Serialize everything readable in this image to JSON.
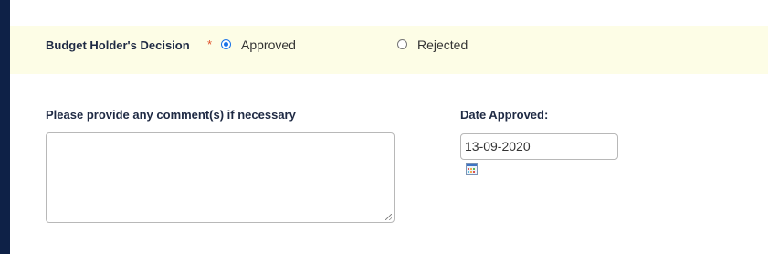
{
  "decision": {
    "label": "Budget Holder's Decision",
    "required_marker": "*",
    "options": [
      {
        "label": "Approved",
        "selected": true
      },
      {
        "label": "Rejected",
        "selected": false
      }
    ]
  },
  "comments": {
    "label": "Please provide any comment(s) if necessary",
    "value": ""
  },
  "date_approved": {
    "label": "Date Approved:",
    "value": "13-09-2020",
    "icon": "calendar-icon"
  },
  "colors": {
    "sidebar": "#0e2147",
    "decision_band": "#fdfde6",
    "required_marker": "#e0502a",
    "radio_selected": "#1a73e8"
  }
}
